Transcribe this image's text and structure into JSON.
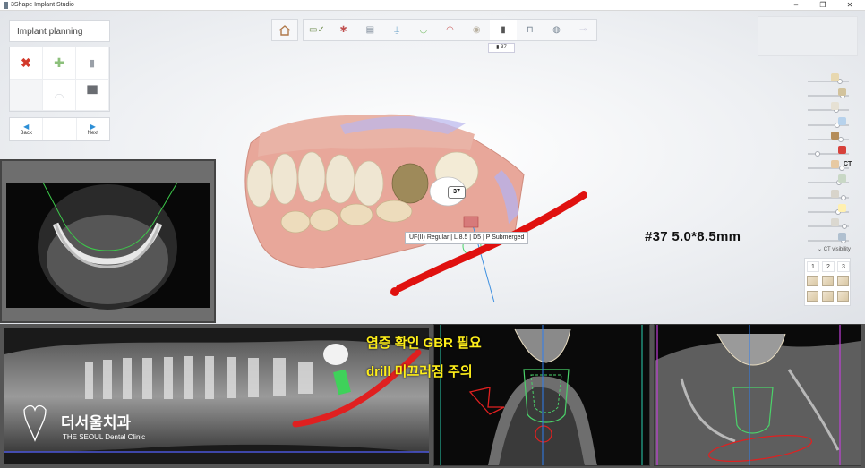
{
  "window": {
    "title": "3Shape Implant Studio",
    "minimize": "–",
    "maximize": "❐",
    "close": "✕"
  },
  "left_panel": {
    "title": "Implant planning",
    "tools": [
      {
        "icon": "delete-icon",
        "glyph": "✖"
      },
      {
        "icon": "add-icon",
        "glyph": "✚"
      },
      {
        "icon": "implant-icon",
        "glyph": "▮"
      },
      {
        "icon": "empty",
        "glyph": ""
      },
      {
        "icon": "tooth-outline-icon",
        "glyph": "⌓"
      },
      {
        "icon": "sleeve-icon",
        "glyph": "▀"
      }
    ],
    "back_label": "Back",
    "next_label": "Next"
  },
  "toolbar": {
    "steps": [
      "home-icon",
      "checklist-icon",
      "align-icon",
      "scan-icon",
      "nerve-icon",
      "bite-icon",
      "crown-icon",
      "implant-icon",
      "guide-icon",
      "sphere-icon",
      "disabled-icon"
    ],
    "active_tooltip": "37"
  },
  "viewport": {
    "tooth_number": "37",
    "implant_info": "UF(II) Regular | L 8.5 | D5 | P Submerged",
    "implant_label": "#37 5.0*8.5mm"
  },
  "right_panel": {
    "ct_label": "CT",
    "ct_visibility": "CT visibility",
    "view_numbers": [
      "1",
      "2",
      "3"
    ],
    "slider_levels": [
      0.82,
      0.9,
      0.72,
      0.75,
      0.85,
      0.2,
      0.88,
      0.8,
      0.92,
      0.78,
      0.95,
      0.93
    ],
    "slider_icon_colors": [
      "#e8d8b0",
      "#d2c39d",
      "#e6e1d4",
      "#b7d2ec",
      "#b48d5a",
      "#d7413b",
      "#e7c9a2",
      "#c9d8c6",
      "#d8d4cb",
      "#fff0b0",
      "#dbd8d0",
      "#b0c0d0"
    ]
  },
  "annotations": {
    "line1": "염증 확인 GBR 필요",
    "line2": "drill 미끄러짐 주의"
  },
  "watermark": {
    "name": "더서울치과",
    "sub": "THE SEOUL Dental Clinic"
  },
  "colors": {
    "accent": "#2d8fd6",
    "delete_red": "#d23a2c",
    "add_green": "#8cc07b",
    "nerve_red": "#e0110f",
    "implant_green": "#4bd36a",
    "note_yellow": "#ffef1a"
  }
}
